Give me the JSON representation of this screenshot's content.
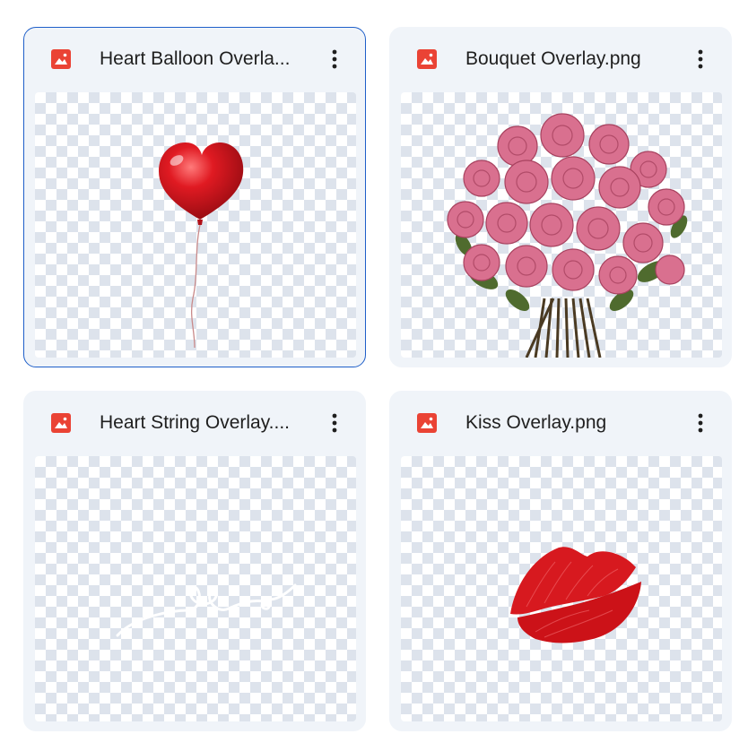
{
  "files": [
    {
      "name": "Heart Balloon Overlay.png",
      "display_name": "Heart Balloon Overla...",
      "icon": "image-file-icon",
      "selected": true
    },
    {
      "name": "Bouquet Overlay.png",
      "display_name": "Bouquet Overlay.png",
      "icon": "image-file-icon",
      "selected": false
    },
    {
      "name": "Heart String Overlay.png",
      "display_name": "Heart String Overlay....",
      "icon": "image-file-icon",
      "selected": false
    },
    {
      "name": "Kiss Overlay.png",
      "display_name": "Kiss Overlay.png",
      "icon": "image-file-icon",
      "selected": false
    }
  ],
  "colors": {
    "icon_red": "#ea4335",
    "selected_border": "#1f5fc9",
    "card_bg": "#f0f4f9"
  }
}
